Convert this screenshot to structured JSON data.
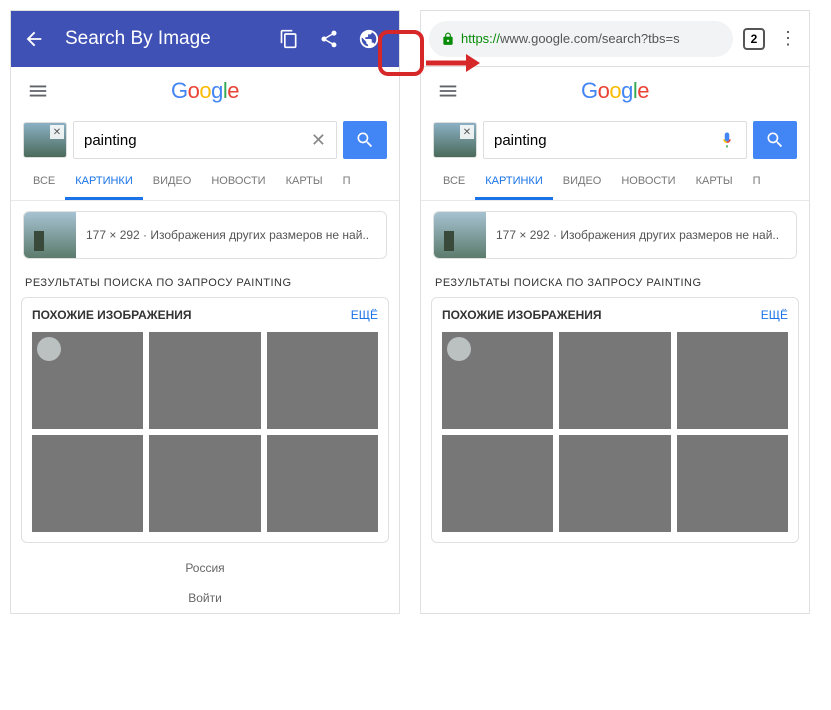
{
  "left": {
    "appBar": {
      "title": "Search By Image"
    },
    "search": {
      "query": "painting"
    },
    "tabs": [
      "ВСЕ",
      "КАРТИНКИ",
      "ВИДЕО",
      "НОВОСТИ",
      "КАРТЫ",
      "П"
    ],
    "activeTab": 1,
    "sizeInfo": "177 × 292 · Изображения других размеров не най..",
    "resultsTitle": "РЕЗУЛЬТАТЫ ПОИСКА ПО ЗАПРОСУ PAINTING",
    "similarLabel": "ПОХОЖИЕ ИЗОБРАЖЕНИЯ",
    "moreLabel": "ЕЩЁ",
    "footer": {
      "country": "Россия",
      "signin": "Войти"
    }
  },
  "right": {
    "url": {
      "https": "https://",
      "rest": "www.google.com/search?tbs=s"
    },
    "tabCount": "2",
    "search": {
      "query": "painting"
    },
    "tabs": [
      "ВСЕ",
      "КАРТИНКИ",
      "ВИДЕО",
      "НОВОСТИ",
      "КАРТЫ",
      "П"
    ],
    "activeTab": 1,
    "sizeInfo": "177 × 292 · Изображения других размеров не най..",
    "resultsTitle": "РЕЗУЛЬТАТЫ ПОИСКА ПО ЗАПРОСУ PAINTING",
    "similarLabel": "ПОХОЖИЕ ИЗОБРАЖЕНИЯ",
    "moreLabel": "ЕЩЁ"
  },
  "logo": {
    "g1": "G",
    "o1": "o",
    "o2": "o",
    "g2": "g",
    "l": "l",
    "e": "e"
  }
}
